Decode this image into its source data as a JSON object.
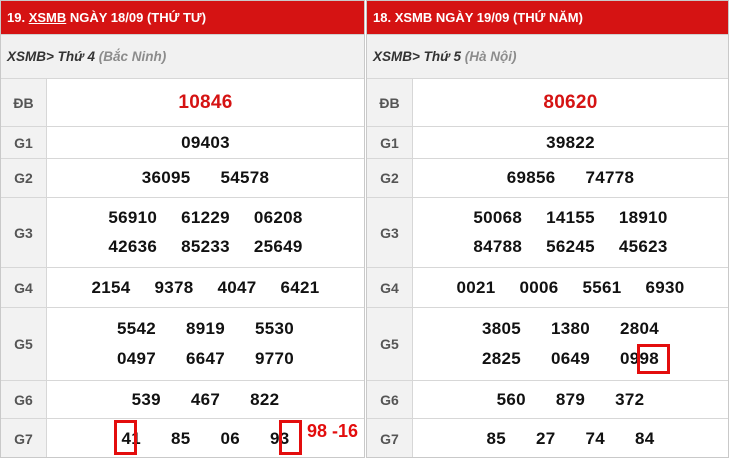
{
  "left": {
    "header": {
      "prefix": "19. ",
      "xsmb": "XSMB",
      "rest": " NGÀY 18/09 (THỨ TƯ)"
    },
    "sub": {
      "prefix": "XSMB> Thứ 4 ",
      "location": "(Bắc Ninh)"
    },
    "labels": {
      "db": "ĐB",
      "g1": "G1",
      "g2": "G2",
      "g3": "G3",
      "g4": "G4",
      "g5": "G5",
      "g6": "G6",
      "g7": "G7"
    },
    "db": [
      "10846"
    ],
    "g1": [
      "09403"
    ],
    "g2": [
      "36095",
      "54578"
    ],
    "g3": [
      [
        "56910",
        "61229",
        "06208"
      ],
      [
        "42636",
        "85233",
        "25649"
      ]
    ],
    "g4": [
      "2154",
      "9378",
      "4047",
      "6421"
    ],
    "g5": [
      [
        "5542",
        "8919",
        "5530"
      ],
      [
        "0497",
        "6647",
        "9770"
      ]
    ],
    "g6": [
      "539",
      "467",
      "822"
    ],
    "g7": [
      "41",
      "85",
      "06",
      "93"
    ]
  },
  "right": {
    "header": {
      "prefix": "18. ",
      "xsmb": "XSMB",
      "rest": " NGÀY 19/09 (THỨ NĂM)"
    },
    "sub": {
      "prefix": "XSMB> Thứ 5 ",
      "location": "(Hà Nội)"
    },
    "labels": {
      "db": "ĐB",
      "g1": "G1",
      "g2": "G2",
      "g3": "G3",
      "g4": "G4",
      "g5": "G5",
      "g6": "G6",
      "g7": "G7"
    },
    "db": [
      "80620"
    ],
    "g1": [
      "39822"
    ],
    "g2": [
      "69856",
      "74778"
    ],
    "g3": [
      [
        "50068",
        "14155",
        "18910"
      ],
      [
        "84788",
        "56245",
        "45623"
      ]
    ],
    "g4": [
      "0021",
      "0006",
      "5561",
      "6930"
    ],
    "g5": [
      [
        "3805",
        "1380",
        "2804"
      ],
      [
        "2825",
        "0649",
        "0998"
      ]
    ],
    "g6": [
      "560",
      "879",
      "372"
    ],
    "g7": [
      "85",
      "27",
      "74",
      "84"
    ]
  },
  "annotation": {
    "text": "98 -16",
    "color": "#e30d0d"
  },
  "colors": {
    "header_bg": "#d51313",
    "special_prize": "#d51313",
    "highlight": "#e30d0d"
  }
}
